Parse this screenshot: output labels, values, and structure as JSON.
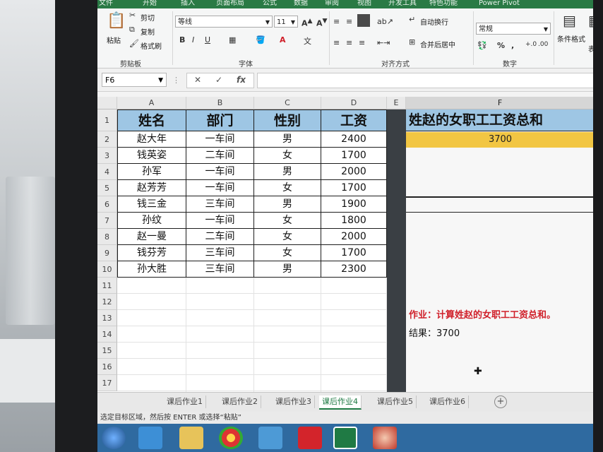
{
  "ribbon": {
    "tabs": [
      "文件",
      "开始",
      "插入",
      "页面布局",
      "公式",
      "数据",
      "审阅",
      "视图",
      "开发工具",
      "特色功能",
      "Power Pivot"
    ],
    "clipboard": {
      "paste": "粘贴",
      "cut": "剪切",
      "copy": "复制",
      "format_painter": "格式刷",
      "label": "剪贴板"
    },
    "font": {
      "name": "等线",
      "size": "11",
      "label": "字体"
    },
    "alignment": {
      "wrap": "自动换行",
      "merge": "合并后居中",
      "label": "对齐方式"
    },
    "number": {
      "format": "常规",
      "label": "数字"
    },
    "styles": {
      "conditional": "条件格式",
      "table": "表格"
    }
  },
  "formula_bar": {
    "name_box": "F6",
    "formula": ""
  },
  "grid": {
    "columns": [
      "A",
      "B",
      "C",
      "D",
      "E",
      "F"
    ],
    "row_numbers": [
      "1",
      "2",
      "3",
      "4",
      "5",
      "6",
      "7",
      "8",
      "9",
      "10",
      "11",
      "12",
      "13",
      "14",
      "15",
      "16",
      "17"
    ],
    "headers": [
      "姓名",
      "部门",
      "性别",
      "工资"
    ],
    "rows": [
      [
        "赵大年",
        "一车间",
        "男",
        "2400"
      ],
      [
        "钱英姿",
        "二车间",
        "女",
        "1700"
      ],
      [
        "孙军",
        "一车间",
        "男",
        "2000"
      ],
      [
        "赵芳芳",
        "一车间",
        "女",
        "1700"
      ],
      [
        "钱三金",
        "三车间",
        "男",
        "1900"
      ],
      [
        "孙纹",
        "一车间",
        "女",
        "1800"
      ],
      [
        "赵一曼",
        "二车间",
        "女",
        "2000"
      ],
      [
        "钱芬芳",
        "三车间",
        "女",
        "1700"
      ],
      [
        "孙大胜",
        "三车间",
        "男",
        "2300"
      ]
    ],
    "f_title": "姓赵的女职工工资总和",
    "f_value": "3700",
    "homework": "作业：计算姓赵的女职工工资总和。",
    "result": "结果：3700"
  },
  "sheets": [
    "课后作业1",
    "课后作业2",
    "课后作业3",
    "课后作业4",
    "课后作业5",
    "课后作业6"
  ],
  "active_sheet": "课后作业4",
  "status": "选定目标区域，然后按 ENTER 或选择“粘贴”",
  "colors": {
    "header_fill": "#9ec6e4",
    "result_fill": "#f2c643",
    "homework_text": "#d0202a",
    "excel_green": "#1f7a44"
  }
}
